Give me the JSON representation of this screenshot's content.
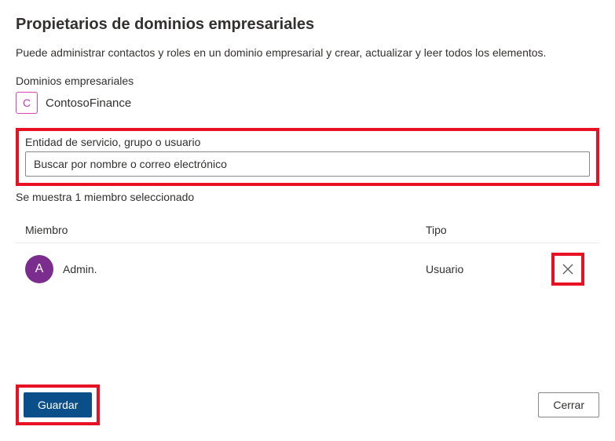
{
  "header": {
    "title": "Propietarios de dominios empresariales",
    "description": "Puede administrar contactos y roles en un dominio empresarial y crear, actualizar y leer todos los elementos."
  },
  "domains": {
    "label": "Dominios empresariales",
    "badge_letter": "C",
    "name": "ContosoFinance"
  },
  "search": {
    "label": "Entidad de servicio, grupo o usuario",
    "placeholder": "Buscar por nombre o correo electrónico"
  },
  "members": {
    "count_text": "Se muestra 1 miembro seleccionado",
    "columns": {
      "member": "Miembro",
      "type": "Tipo"
    },
    "rows": [
      {
        "avatar_letter": "A",
        "name": "Admin.",
        "type": "Usuario"
      }
    ]
  },
  "footer": {
    "save_label": "Guardar",
    "close_label": "Cerrar"
  }
}
